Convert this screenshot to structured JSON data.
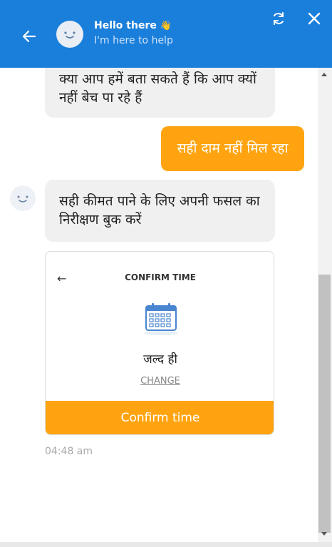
{
  "header": {
    "title": "Hello there",
    "wave_icon": "👋",
    "subtitle": "I'm here to help"
  },
  "colors": {
    "header_bg": "#1a7fdb",
    "accent": "#ffa410",
    "bot_bubble_bg": "#f0f0f0"
  },
  "icons": [
    "back-arrow-icon",
    "bot-avatar-icon",
    "refresh-icon",
    "close-icon",
    "calendar-icon"
  ],
  "chat": {
    "messages": [
      {
        "sender": "bot",
        "text": "क्या आप हमें बता सकते हैं कि आप क्यों नहीं बेच पा रहे हैं"
      },
      {
        "sender": "user",
        "text": "सही दाम नहीं मिल रहा"
      },
      {
        "sender": "bot",
        "text": "सही कीमत पाने के लिए अपनी फसल का निरीक्षण बुक करें"
      }
    ],
    "card": {
      "back_arrow": "←",
      "title": "CONFIRM TIME",
      "selected_time": "जल्द ही",
      "change_label": "CHANGE",
      "confirm_label": "Confirm time"
    },
    "timestamp": "04:48 am"
  }
}
